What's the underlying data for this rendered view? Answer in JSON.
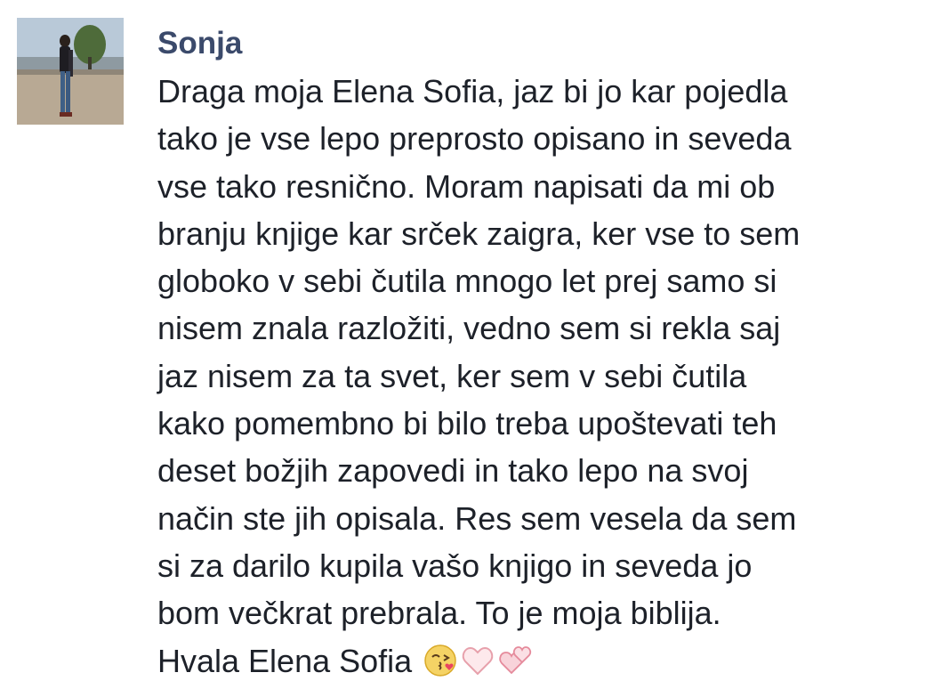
{
  "comment": {
    "author": "Sonja",
    "avatar_icon": "profile-photo-icon",
    "text_lines": [
      "Draga moja Elena Sofia, jaz bi jo kar pojedla",
      "tako je vse lepo preprosto opisano in seveda",
      "vse tako resnično. Moram napisati da mi ob",
      "branju knjige kar srček zaigra, ker vse to sem",
      "globoko v sebi čutila mnogo let prej samo si",
      "nisem znala razložiti, vedno sem si rekla saj",
      "jaz nisem za ta svet, ker sem v sebi čutila",
      "kako pomembno bi bilo treba upoštevati teh",
      "deset božjih zapovedi in tako lepo na svoj",
      "način ste jih opisala. Res sem vesela da sem",
      "si za darilo kupila vašo knjigo in seveda jo",
      "bom večkrat prebrala. To je moja biblija."
    ],
    "closing": "Hvala Elena Sofia",
    "emojis": [
      "kissing-face-icon",
      "white-heart-icon",
      "two-hearts-icon"
    ]
  },
  "colors": {
    "author": "#3b4a6b",
    "text": "#1d2129",
    "background": "#ffffff"
  }
}
